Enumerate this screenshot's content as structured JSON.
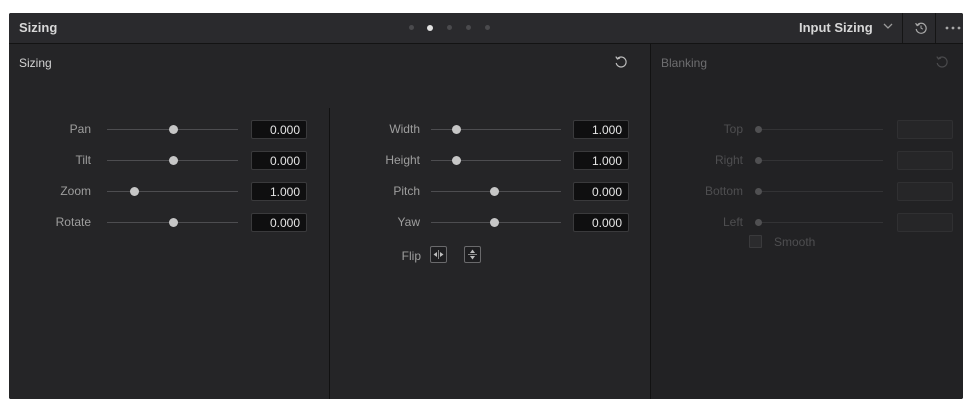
{
  "header": {
    "title": "Sizing",
    "page_dots": [
      false,
      true,
      false,
      false,
      false
    ],
    "mode_label": "Input Sizing",
    "icons": {
      "mode_chevron": "chevron-down-icon",
      "reset": "reset-icon",
      "more": "more-icon"
    }
  },
  "sizing_panel": {
    "title": "Sizing",
    "preset_icon": "reset-icon",
    "left_column": [
      {
        "label": "Pan",
        "value": "0.000",
        "level": 0.5
      },
      {
        "label": "Tilt",
        "value": "0.000",
        "level": 0.5
      },
      {
        "label": "Zoom",
        "value": "1.000",
        "level": 0.2
      },
      {
        "label": "Rotate",
        "value": "0.000",
        "level": 0.5
      }
    ],
    "right_column": [
      {
        "label": "Width",
        "value": "1.000",
        "level": 0.2
      },
      {
        "label": "Height",
        "value": "1.000",
        "level": 0.2
      },
      {
        "label": "Pitch",
        "value": "0.000",
        "level": 0.5
      },
      {
        "label": "Yaw",
        "value": "0.000",
        "level": 0.5
      }
    ],
    "flip_label": "Flip",
    "flip_icons": [
      "flip-horizontal-icon",
      "flip-vertical-icon"
    ]
  },
  "blanking_panel": {
    "title": "Blanking",
    "preset_icon": "reset-icon",
    "rows": [
      {
        "label": "Top",
        "value": ""
      },
      {
        "label": "Right",
        "value": ""
      },
      {
        "label": "Bottom",
        "value": ""
      },
      {
        "label": "Left",
        "value": ""
      }
    ],
    "smooth_label": "Smooth",
    "smooth_checked": false
  }
}
